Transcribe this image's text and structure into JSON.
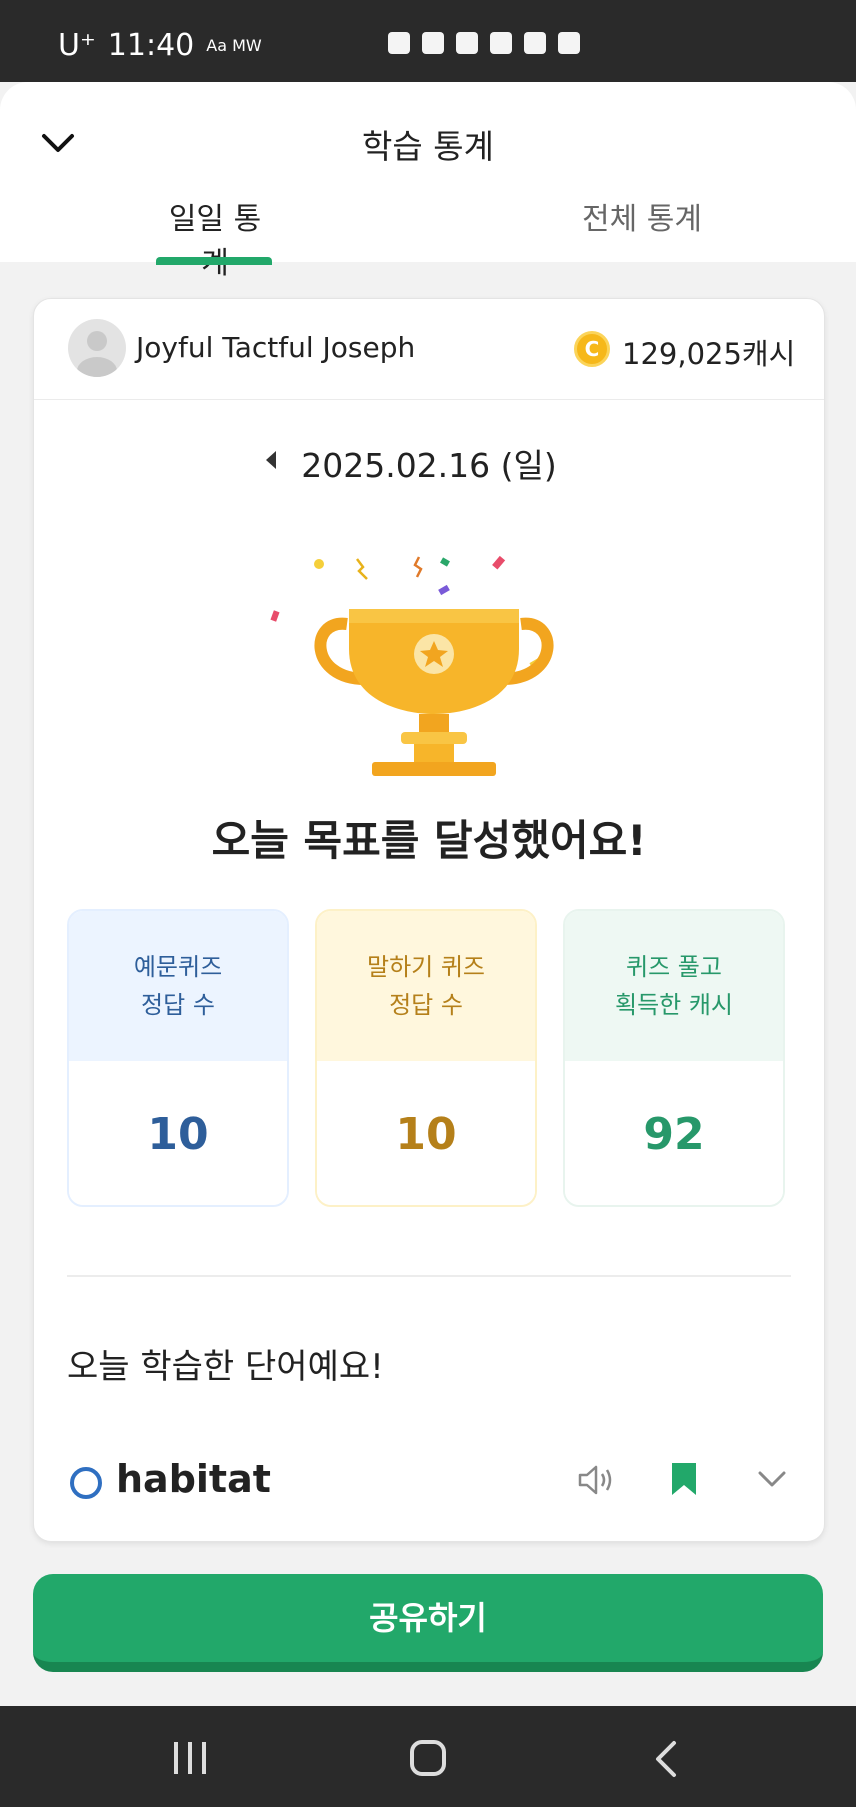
{
  "status_bar": {
    "carrier": "U⁺",
    "time": "11:40",
    "extra": "Aa MW"
  },
  "header": {
    "title": "학습 통계",
    "tabs": [
      {
        "label": "일일 통계"
      },
      {
        "label": "전체 통계"
      }
    ]
  },
  "user": {
    "name": "Joyful Tactful Joseph",
    "cash": "129,025캐시",
    "coin_symbol": "C"
  },
  "date": {
    "label": "2025.02.16 (일)"
  },
  "goal": {
    "message": "오늘 목표를 달성했어요!"
  },
  "stats": [
    {
      "title_line1": "예문퀴즈",
      "title_line2": "정답 수",
      "value": "10"
    },
    {
      "title_line1": "말하기 퀴즈",
      "title_line2": "정답 수",
      "value": "10"
    },
    {
      "title_line1": "퀴즈 풀고",
      "title_line2": "획득한 캐시",
      "value": "92"
    }
  ],
  "words": {
    "heading": "오늘 학습한 단어예요!",
    "items": [
      {
        "word": "habitat"
      }
    ]
  },
  "actions": {
    "share_label": "공유하기"
  },
  "colors": {
    "accent": "#22a86a",
    "blue": "#2e5e9a",
    "gold": "#b5801a",
    "green": "#27986a"
  },
  "icons": [
    "chevron-down-icon",
    "coin-icon",
    "trophy-icon",
    "speaker-icon",
    "bookmark-icon",
    "recent-apps-icon",
    "home-icon",
    "back-nav-icon"
  ]
}
